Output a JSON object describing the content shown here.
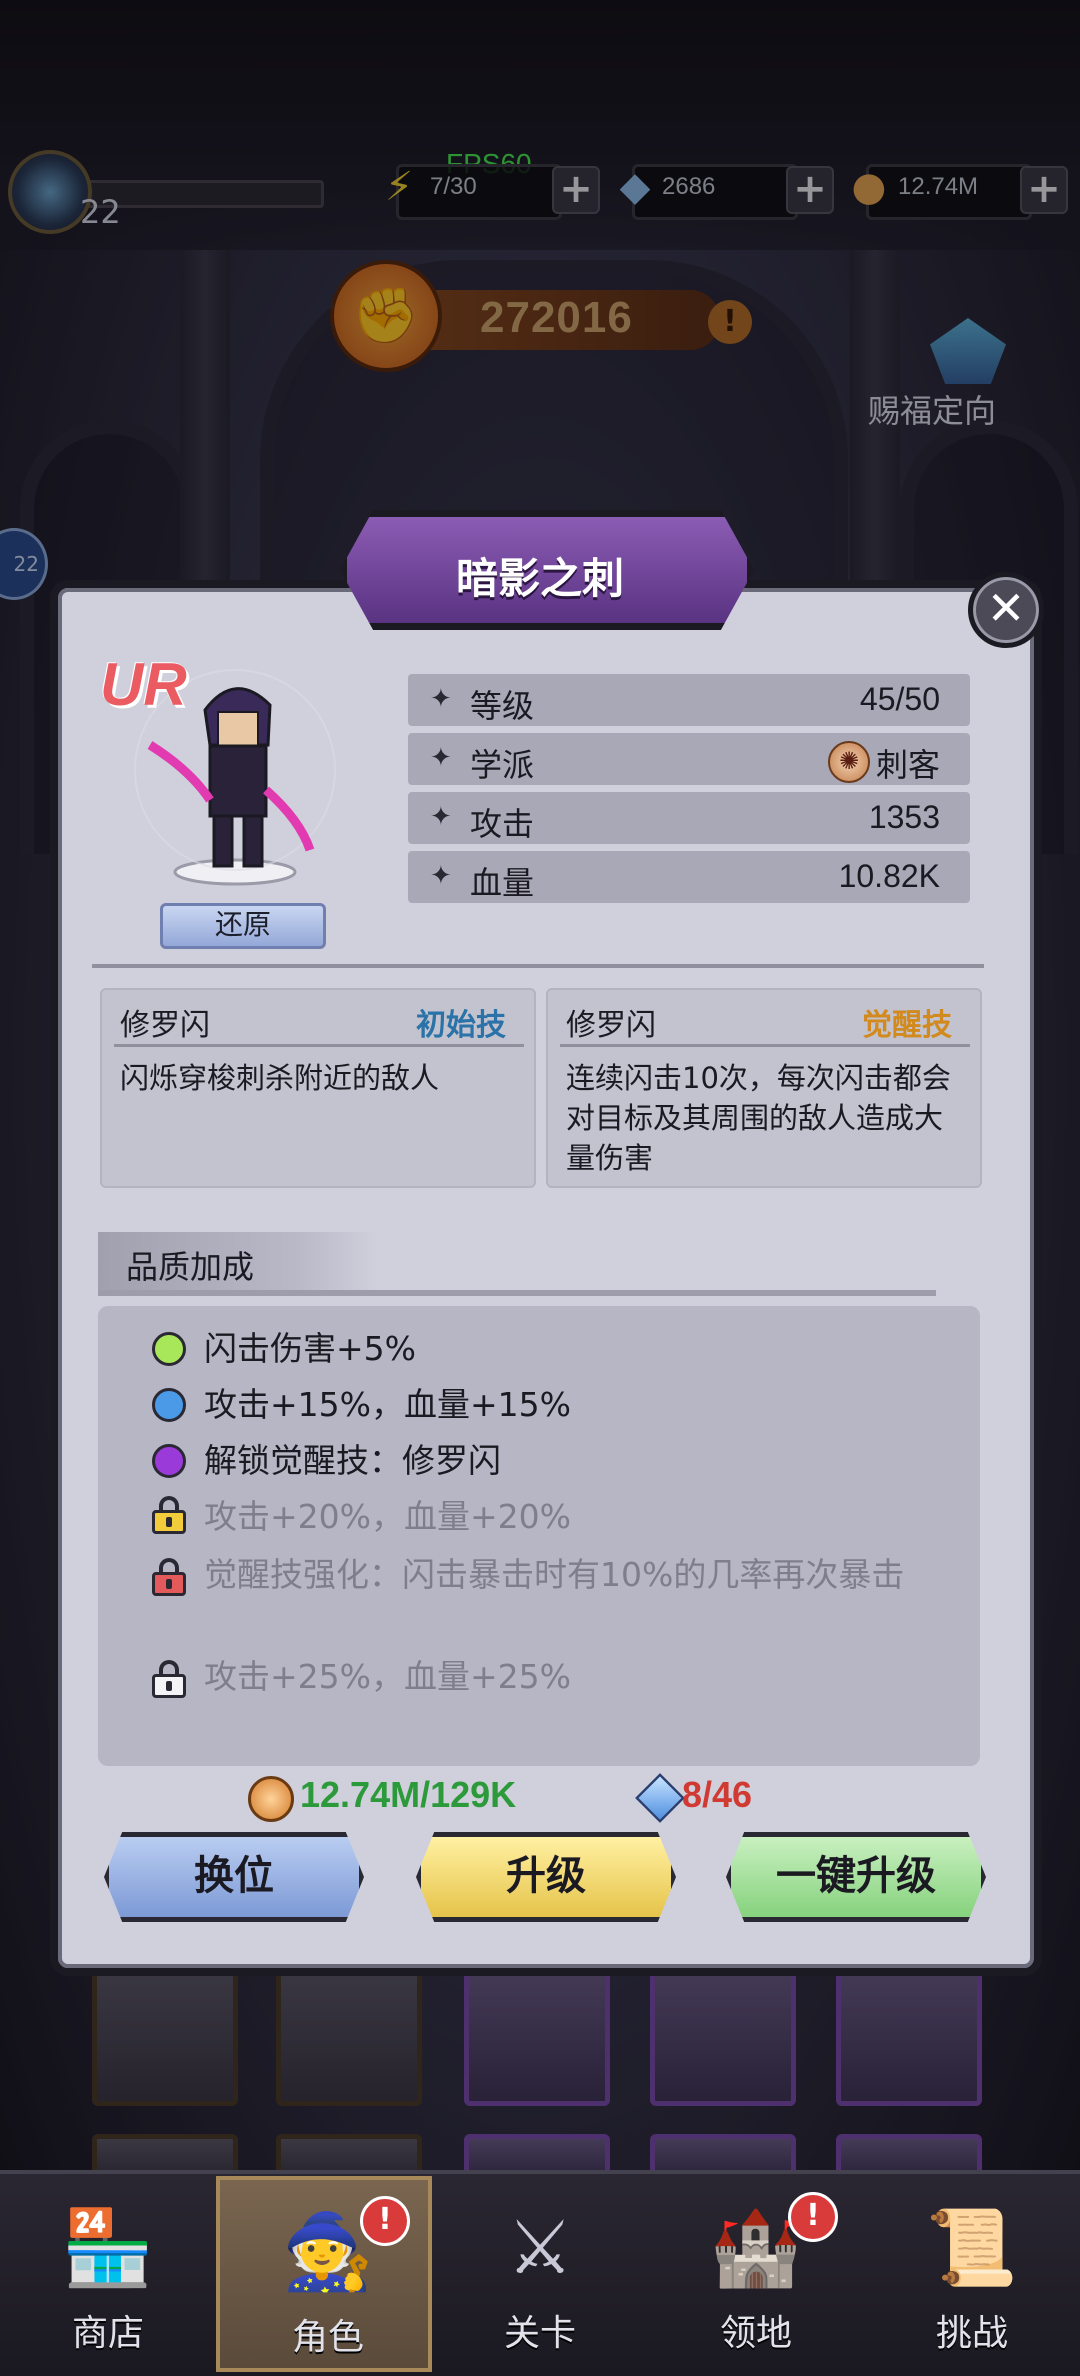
{
  "hud": {
    "fps": "FPS60",
    "player_level": "22",
    "energy": "7/30",
    "gems": "2686",
    "gold": "12.74M",
    "power": "272016",
    "power_alert": "!",
    "bless_label": "赐福定向",
    "side_bubble": "22"
  },
  "hero": {
    "title": "暗影之刺",
    "rarity": "UR",
    "restore_label": "还原",
    "stats": [
      {
        "label": "等级",
        "value": "45/50"
      },
      {
        "label": "学派",
        "value": "刺客"
      },
      {
        "label": "攻击",
        "value": "1353"
      },
      {
        "label": "血量",
        "value": "10.82K"
      }
    ]
  },
  "skills": [
    {
      "name": "修罗闪",
      "type": "初始技",
      "type_color": "#2a72a8",
      "desc": "闪烁穿梭刺杀附近的敌人"
    },
    {
      "name": "修罗闪",
      "type": "觉醒技",
      "type_color": "#d28a1e",
      "desc": "连续闪击10次，每次闪击都会对目标及其周围的敌人造成大量伤害"
    }
  ],
  "quality": {
    "title": "品质加成",
    "items": [
      {
        "text": "闪击伤害+5%",
        "kind": "dot",
        "color": "#a8e65a",
        "unlocked": true
      },
      {
        "text": "攻击+15%，血量+15%",
        "kind": "dot",
        "color": "#4a9ae8",
        "unlocked": true
      },
      {
        "text": "解锁觉醒技：修罗闪",
        "kind": "dot",
        "color": "#9a3ad8",
        "unlocked": true
      },
      {
        "text": "攻击+20%，血量+20%",
        "kind": "lock",
        "color": "#f2cc3a",
        "unlocked": false
      },
      {
        "text": "觉醒技强化：闪击暴击时有10%的几率再次暴击",
        "kind": "lock",
        "color": "#e25a5a",
        "unlocked": false
      },
      {
        "text": "攻击+25%，血量+25%",
        "kind": "lock",
        "color": "#f4f4f6",
        "unlocked": false
      }
    ]
  },
  "costs": {
    "gold": "12.74M/129K",
    "gem": "8/46"
  },
  "buttons": {
    "swap": "换位",
    "upgrade": "升级",
    "one_click": "一键升级"
  },
  "close_label": "✕",
  "nav": [
    {
      "label": "商店",
      "icon": "shop-icon",
      "glyph": "🏪",
      "active": false,
      "badge": ""
    },
    {
      "label": "角色",
      "icon": "character-icon",
      "glyph": "🧙",
      "active": true,
      "badge": "!"
    },
    {
      "label": "关卡",
      "icon": "crossed-swords-icon",
      "glyph": "⚔",
      "active": false,
      "badge": ""
    },
    {
      "label": "领地",
      "icon": "castle-icon",
      "glyph": "🏰",
      "active": false,
      "badge": "!"
    },
    {
      "label": "挑战",
      "icon": "challenge-scroll-icon",
      "glyph": "📜",
      "active": false,
      "badge": ""
    }
  ]
}
